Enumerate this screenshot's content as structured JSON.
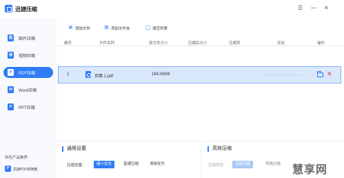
{
  "app": {
    "title": "迅捷压缩"
  },
  "window_controls": [
    "☰",
    "—",
    "✕"
  ],
  "sidebar": {
    "items": [
      {
        "label": "图片压缩",
        "icon": "image-icon",
        "glyph": "图",
        "active": false
      },
      {
        "label": "视频压缩",
        "icon": "video-icon",
        "glyph": "视",
        "active": false
      },
      {
        "label": "PDF压缩",
        "icon": "pdf-icon",
        "glyph": "P",
        "active": true
      },
      {
        "label": "Word压缩",
        "icon": "word-icon",
        "glyph": "W",
        "active": false
      },
      {
        "label": "PPT压缩",
        "icon": "ppt-icon",
        "glyph": "P",
        "active": false
      }
    ],
    "promo_title": "特色产品推荐",
    "promo_item": {
      "label": "迅捷PDF转换器",
      "glyph": "P"
    }
  },
  "toolbar": {
    "add_file": "添加文件",
    "add_folder": "添加文件夹",
    "clear_list": "清空列表"
  },
  "table": {
    "headers": [
      "编号",
      "文件名称",
      "原文件大小",
      "压缩后大小",
      "压缩率",
      "状态",
      "操作"
    ],
    "rows": [
      {
        "index": "1",
        "name": "页面 1.pdf",
        "size": "184.06KB",
        "compressed": "",
        "ratio": "",
        "status": ""
      }
    ]
  },
  "settings": {
    "title": "通用设置",
    "label": "压缩设置:",
    "options": [
      "缩小优先",
      "普通压缩",
      "清晰优先"
    ],
    "selected": "缩小优先"
  },
  "compress": {
    "title": "高效压缩",
    "label": "压缩类型:",
    "options": [
      "直接压缩",
      "转换压缩"
    ],
    "selected": "直接压缩"
  },
  "watermark": "慧享网",
  "colors": {
    "accent": "#2f7cf6",
    "row_highlight": "#d9e8fb",
    "delete": "#e23b3b"
  }
}
